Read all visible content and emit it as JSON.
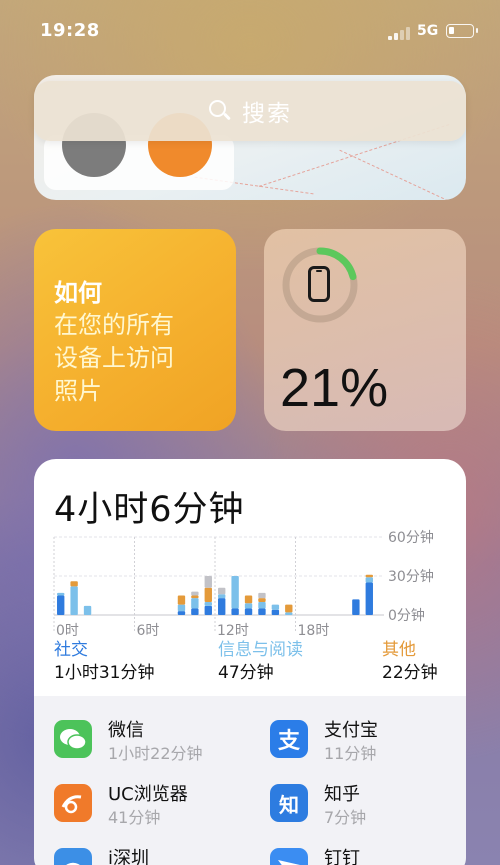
{
  "status_bar": {
    "time": "19:28",
    "network": "5G",
    "battery_level": 0.21
  },
  "search": {
    "label": "搜索"
  },
  "tips": {
    "title": "如何",
    "lines": [
      "在您的所有",
      "设备上访问",
      "照片"
    ]
  },
  "battery_widget": {
    "percent_text": "21%",
    "level": 0.21,
    "ring_color": "#5cc85c"
  },
  "screen_time": {
    "total": "4小时6分钟",
    "categories": [
      {
        "name": "社交",
        "time": "1小时31分钟",
        "color": "#2f7bde"
      },
      {
        "name": "信息与阅读",
        "time": "47分钟",
        "color": "#7cc0ea"
      },
      {
        "name": "其他",
        "time": "22分钟",
        "color": "#e49a3a"
      }
    ],
    "apps": [
      {
        "name": "微信",
        "time": "1小时22分钟",
        "icon": "wechat-icon",
        "color": "#4cc35a"
      },
      {
        "name": "支付宝",
        "time": "11分钟",
        "icon": "alipay-icon",
        "color": "#2b7de8"
      },
      {
        "name": "UC浏览器",
        "time": "41分钟",
        "icon": "uc-browser-icon",
        "color": "#f07a2a"
      },
      {
        "name": "知乎",
        "time": "7分钟",
        "icon": "zhihu-icon",
        "color": "#2d7ce0"
      },
      {
        "name": "i深圳",
        "time": "",
        "icon": "ishenzhen-icon",
        "color": "#3c8fe6"
      },
      {
        "name": "钉钉",
        "time": "",
        "icon": "dingtalk-icon",
        "color": "#3b8df2"
      }
    ]
  },
  "chart_data": {
    "type": "bar",
    "x_ticks": [
      "0时",
      "6时",
      "12时",
      "18时"
    ],
    "y_ticks": [
      "60分钟",
      "30分钟",
      "0分钟"
    ],
    "ylim": [
      0,
      60
    ],
    "bar_count": 24,
    "series": [
      {
        "name": "社交",
        "values": [
          15,
          0,
          0,
          0,
          0,
          0,
          0,
          0,
          0,
          3,
          5,
          7,
          13,
          5,
          5,
          5,
          4,
          0,
          0,
          0,
          0,
          0,
          12,
          25
        ]
      },
      {
        "name": "信息与阅读",
        "values": [
          2,
          22,
          7,
          0,
          0,
          0,
          0,
          0,
          0,
          5,
          8,
          3,
          3,
          25,
          4,
          5,
          4,
          2,
          0,
          0,
          0,
          0,
          0,
          4
        ]
      },
      {
        "name": "其他",
        "values": [
          0,
          4,
          0,
          0,
          0,
          0,
          0,
          0,
          0,
          7,
          2,
          11,
          0,
          0,
          6,
          3,
          0,
          6,
          0,
          0,
          0,
          0,
          0,
          2
        ]
      },
      {
        "name": "",
        "values": [
          0,
          0,
          0,
          0,
          0,
          0,
          0,
          0,
          0,
          0,
          3,
          9,
          5,
          0,
          0,
          4,
          0,
          0,
          0,
          0,
          0,
          0,
          0,
          0
        ]
      }
    ]
  }
}
